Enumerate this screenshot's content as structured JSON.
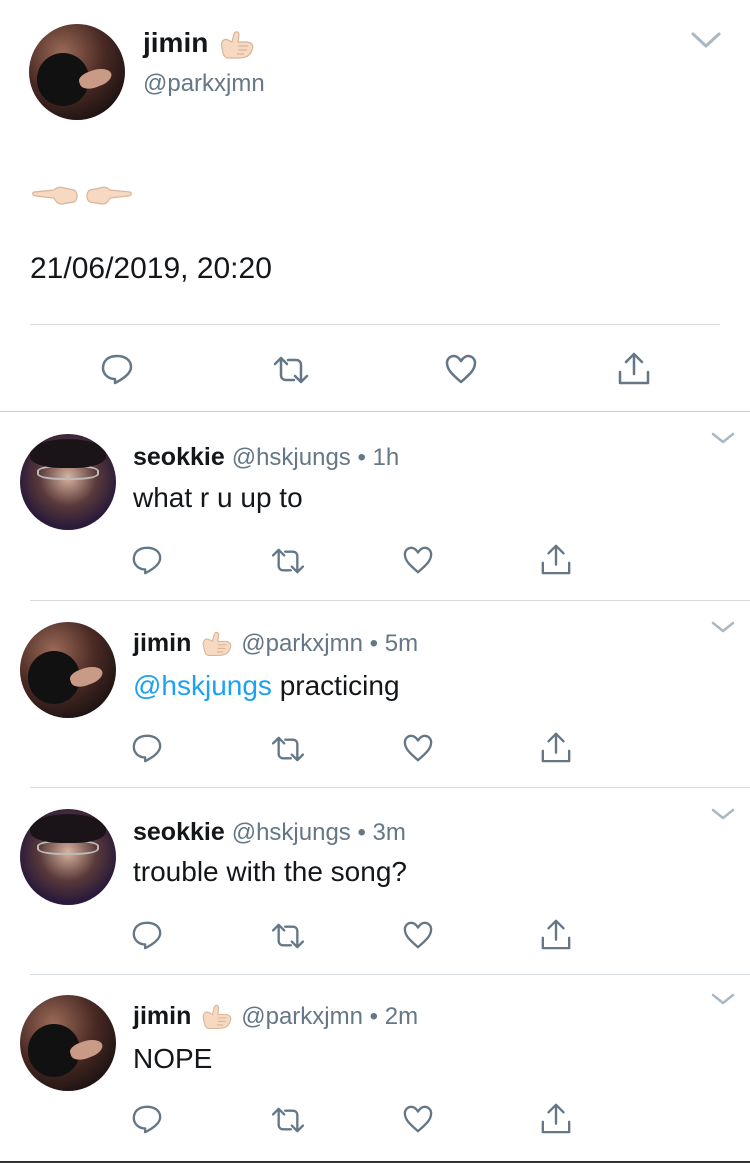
{
  "main_tweet": {
    "display_name": "jimin",
    "handle": "@parkxjmn",
    "text": "👉👈",
    "timestamp": "21/06/2019, 20:20",
    "name_emoji_icon": "call-me-hand-icon"
  },
  "replies": [
    {
      "display_name": "seokkie",
      "handle": "@hskjungs",
      "time": "1h",
      "mention": "",
      "text": "what r u up to",
      "has_emoji": false
    },
    {
      "display_name": "jimin",
      "handle": "@parkxjmn",
      "time": "5m",
      "mention": "@hskjungs",
      "text": " practicing",
      "has_emoji": true
    },
    {
      "display_name": "seokkie",
      "handle": "@hskjungs",
      "time": "3m",
      "mention": "",
      "text": "trouble with the song?",
      "has_emoji": false
    },
    {
      "display_name": "jimin",
      "handle": "@parkxjmn",
      "time": "2m",
      "mention": "",
      "text": "NOPE",
      "has_emoji": true
    }
  ],
  "separator": " • ",
  "colors": {
    "text": "#14171a",
    "secondary": "#657786",
    "mention": "#1da1f2",
    "icon": "#657786",
    "divider": "#d5dade"
  },
  "icons": [
    "reply-icon",
    "retweet-icon",
    "like-icon",
    "share-icon",
    "chevron-down-icon"
  ]
}
